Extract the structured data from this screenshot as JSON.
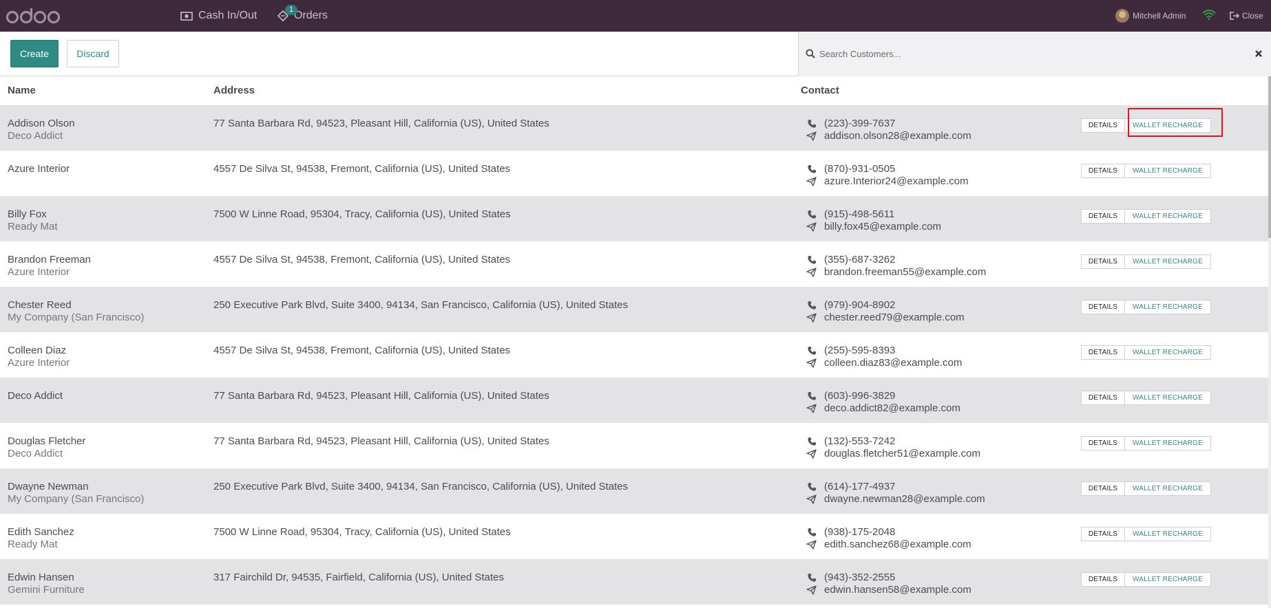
{
  "topbar": {
    "brand": "odoo",
    "cash_label": "Cash In/Out",
    "orders_label": "Orders",
    "orders_badge": "1",
    "user_name": "Mitchell Admin",
    "close_label": "Close",
    "icons": {
      "cash": "money-icon",
      "orders": "ticket-icon",
      "wifi": "wifi-icon",
      "close": "sign-out-icon"
    }
  },
  "controls": {
    "create_label": "Create",
    "discard_label": "Discard",
    "search_placeholder": "Search Customers..."
  },
  "table": {
    "columns": [
      "Name",
      "Address",
      "Contact"
    ],
    "details_label": "DETAILS",
    "wallet_label": "WALLET RECHARGE",
    "rows": [
      {
        "name": "Addison Olson",
        "company": "Deco Addict",
        "address": "77 Santa Barbara Rd, 94523, Pleasant Hill, California (US), United States",
        "phone": "(223)-399-7637",
        "email": "addison.olson28@example.com"
      },
      {
        "name": "Azure Interior",
        "company": "",
        "address": "4557 De Silva St, 94538, Fremont, California (US), United States",
        "phone": "(870)-931-0505",
        "email": "azure.Interior24@example.com"
      },
      {
        "name": "Billy Fox",
        "company": "Ready Mat",
        "address": "7500 W Linne Road, 95304, Tracy, California (US), United States",
        "phone": "(915)-498-5611",
        "email": "billy.fox45@example.com"
      },
      {
        "name": "Brandon Freeman",
        "company": "Azure Interior",
        "address": "4557 De Silva St, 94538, Fremont, California (US), United States",
        "phone": "(355)-687-3262",
        "email": "brandon.freeman55@example.com"
      },
      {
        "name": "Chester Reed",
        "company": "My Company (San Francisco)",
        "address": "250 Executive Park Blvd, Suite 3400, 94134, San Francisco, California (US), United States",
        "phone": "(979)-904-8902",
        "email": "chester.reed79@example.com"
      },
      {
        "name": "Colleen Diaz",
        "company": "Azure Interior",
        "address": "4557 De Silva St, 94538, Fremont, California (US), United States",
        "phone": "(255)-595-8393",
        "email": "colleen.diaz83@example.com"
      },
      {
        "name": "Deco Addict",
        "company": "",
        "address": "77 Santa Barbara Rd, 94523, Pleasant Hill, California (US), United States",
        "phone": "(603)-996-3829",
        "email": "deco.addict82@example.com"
      },
      {
        "name": "Douglas Fletcher",
        "company": "Deco Addict",
        "address": "77 Santa Barbara Rd, 94523, Pleasant Hill, California (US), United States",
        "phone": "(132)-553-7242",
        "email": "douglas.fletcher51@example.com"
      },
      {
        "name": "Dwayne Newman",
        "company": "My Company (San Francisco)",
        "address": "250 Executive Park Blvd, Suite 3400, 94134, San Francisco, California (US), United States",
        "phone": "(614)-177-4937",
        "email": "dwayne.newman28@example.com"
      },
      {
        "name": "Edith Sanchez",
        "company": "Ready Mat",
        "address": "7500 W Linne Road, 95304, Tracy, California (US), United States",
        "phone": "(938)-175-2048",
        "email": "edith.sanchez68@example.com"
      },
      {
        "name": "Edwin Hansen",
        "company": "Gemini Furniture",
        "address": "317 Fairchild Dr, 94535, Fairfield, California (US), United States",
        "phone": "(943)-352-2555",
        "email": "edwin.hansen58@example.com"
      }
    ]
  },
  "colors": {
    "topbar": "#3e2a3a",
    "accent": "#2e8a85",
    "row_alt": "#e3e3e6",
    "highlight": "#e0141e"
  }
}
